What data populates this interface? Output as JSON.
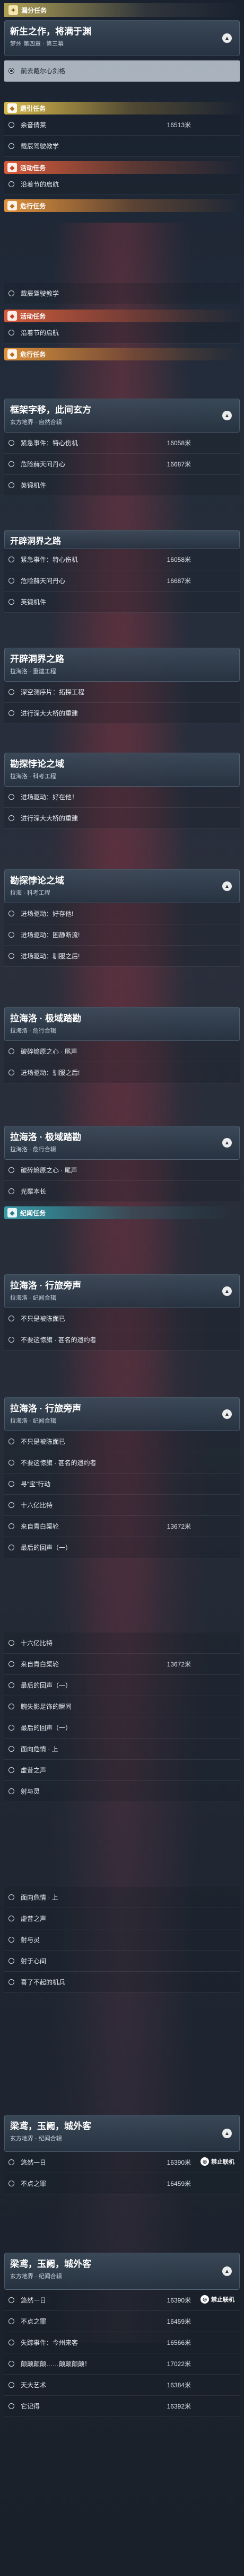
{
  "top_category": {
    "label": "漏分任务"
  },
  "main_card": {
    "title": "新生之作，将满于渊",
    "sub": "梦州 第四章 · 第三幕"
  },
  "highlight_row": {
    "label": "前去戴尔心剑格"
  },
  "cat_yellow": {
    "label": "遗引任务"
  },
  "rows_a": [
    {
      "label": "余音倩莱",
      "dist": "16513米"
    },
    {
      "label": "载辰驾驶教学",
      "dist": ""
    }
  ],
  "cat_activity": {
    "label": "活动任务"
  },
  "row_activity": {
    "label": "沿着节的启航"
  },
  "cat_danger": {
    "label": "危行任务"
  },
  "rows_b": [
    {
      "label": "载辰驾驶教学"
    },
    {
      "label": "活动任务"
    }
  ],
  "cat_activity2": {
    "label": "活动任务"
  },
  "row_activity2": {
    "label": "沿着节的启航"
  },
  "cat_danger2": {
    "label": "危行任务"
  },
  "card1": {
    "title": "框架字移，此间玄方",
    "sub": "玄方地界 · 自然合辑"
  },
  "card1_rows": [
    {
      "label": "紧急事件：特心伤机",
      "dist": "16058米"
    },
    {
      "label": "危险赫天问丹心",
      "dist": "16687米"
    },
    {
      "label": "英锻机件",
      "dist": ""
    }
  ],
  "card2": {
    "title": "开辟洞界之路",
    "sub": ""
  },
  "card2_rows": [
    {
      "label": "紧急事件：特心伤机",
      "dist": "16058米"
    },
    {
      "label": "危险赫天问丹心",
      "dist": "16687米"
    },
    {
      "label": "英锻机件",
      "dist": ""
    }
  ],
  "card3": {
    "title": "开辟洞界之路",
    "sub": "拉海洛 · 重建工程"
  },
  "card3_rows": [
    {
      "label": "深空测序片：拓探工程"
    },
    {
      "label": "进行深大大桥的重建"
    }
  ],
  "card4": {
    "title": "勘探悖论之域",
    "sub": "拉海洛 · 科考工程"
  },
  "card4_rows": [
    {
      "label": "进场驱动：好在他！"
    },
    {
      "label": "进行深大大桥的重建"
    }
  ],
  "card5": {
    "title": "勘探悖论之域",
    "sub": "拉海 · 科考工程"
  },
  "card5_rows": [
    {
      "label": "进场驱动：好存他!"
    },
    {
      "label": "进场驱动：困静断流!"
    },
    {
      "label": "进场驱动：驯服之后!"
    }
  ],
  "card6": {
    "title": "拉海洛 · 极域踏勘",
    "sub": "拉海洛 · 危行合辑"
  },
  "card6_rows": [
    {
      "label": "破碎熵原之心 · 尾声"
    },
    {
      "label": "进场驱动：驯服之后!"
    }
  ],
  "card7": {
    "title": "拉海洛 · 极域踏勘",
    "sub": "拉海洛 · 危行合辑"
  },
  "card7_rows": [
    {
      "label": "破碎熵原之心 · 尾声"
    },
    {
      "label": "光粼本长"
    }
  ],
  "cat_teal": {
    "label": "纪闻任务"
  },
  "card8": {
    "title": "拉海洛 · 行旅旁声",
    "sub": "拉海洛 · 纪闻合辑"
  },
  "card8_rows": [
    {
      "label": "不只是被陈面已"
    },
    {
      "label": "不要这惊旗 · 甚名的遗约者"
    }
  ],
  "card9": {
    "title": "拉海洛 · 行旅旁声",
    "sub": "拉海洛 · 纪闻合辑"
  },
  "card9_rows": [
    {
      "label": "不只是被陈面已",
      "dist": ""
    },
    {
      "label": "不要这惊旗 · 甚名的遗约者",
      "dist": ""
    },
    {
      "label": "寻“宝”行动",
      "dist": ""
    },
    {
      "label": "十六亿比特",
      "dist": ""
    },
    {
      "label": "来自青白渠轮",
      "dist": "13672米"
    },
    {
      "label": "最后的回声（一）",
      "dist": ""
    }
  ],
  "rows_c": [
    {
      "label": "十六亿比特",
      "dist": ""
    },
    {
      "label": "来自青白渠轮",
      "dist": "13672米"
    },
    {
      "label": "最后的回声（一）",
      "dist": ""
    },
    {
      "label": "腕失影足饰的瞬间",
      "dist": ""
    },
    {
      "label": "最后的回声（一）",
      "dist": ""
    },
    {
      "label": "面向危情 · 上",
      "dist": ""
    },
    {
      "label": "虚昔之声",
      "dist": ""
    },
    {
      "label": "射与灵",
      "dist": ""
    }
  ],
  "rows_d": [
    {
      "label": "面向危情 · 上"
    },
    {
      "label": "虚昔之声"
    },
    {
      "label": "射与灵"
    },
    {
      "label": "射于心间"
    },
    {
      "label": "喜了不起的机兵"
    }
  ],
  "card10": {
    "title": "梁鸢，玉阙，城外客",
    "sub": "玄方地界 · 纪闻合辑"
  },
  "card10_rows": [
    {
      "label": "悠然一日",
      "dist": "16390米"
    },
    {
      "label": "不点之罪",
      "dist": "16459米"
    }
  ],
  "card11": {
    "title": "梁鸢，玉阙，城外客",
    "sub": "玄方地界 · 纪闻合辑"
  },
  "card11_rows": [
    {
      "label": "悠然一日",
      "dist": "16390米"
    },
    {
      "label": "不点之罪",
      "dist": "16459米"
    },
    {
      "label": "失踪事件：今州来客",
      "dist": "16566米"
    },
    {
      "label": "颠颠颠颠……颠颠颠颠！",
      "dist": "17022米"
    },
    {
      "label": "天大艺术",
      "dist": "16384米"
    },
    {
      "label": "它记得",
      "dist": "16392米"
    }
  ],
  "watermark": {
    "label": "禁止联机"
  },
  "colors": {
    "accent_gold": "#d8b84a",
    "accent_teal": "#3a9aa8",
    "accent_red": "#d85a3a"
  },
  "icons": {
    "toggle": "chevron-up-icon",
    "badge": "task-star-icon"
  }
}
